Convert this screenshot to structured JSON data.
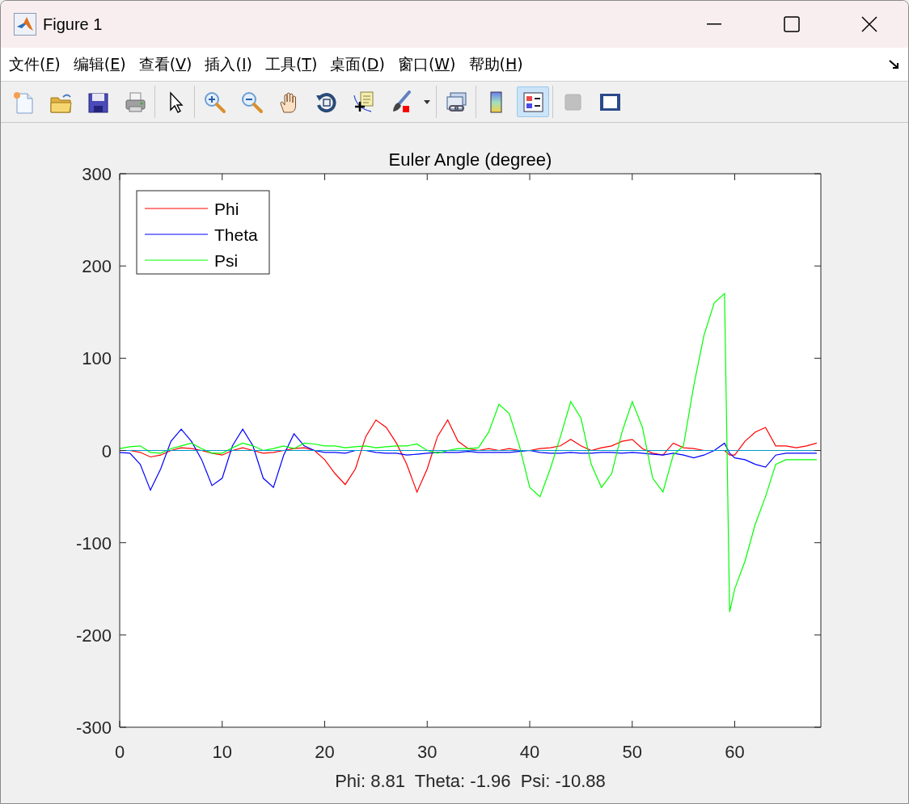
{
  "window": {
    "title": "Figure 1"
  },
  "menu": [
    {
      "label": "文件(F)"
    },
    {
      "label": "编辑(E)"
    },
    {
      "label": "查看(V)"
    },
    {
      "label": "插入(I)"
    },
    {
      "label": "工具(T)"
    },
    {
      "label": "桌面(D)"
    },
    {
      "label": "窗口(W)"
    },
    {
      "label": "帮助(H)"
    }
  ],
  "toolbar": {
    "groups": [
      {
        "tools": [
          {
            "kind": "new",
            "selected": false,
            "disabled": false
          },
          {
            "kind": "open",
            "selected": false,
            "disabled": false
          },
          {
            "kind": "save",
            "selected": false,
            "disabled": false
          },
          {
            "kind": "print",
            "selected": false,
            "disabled": false
          }
        ]
      },
      {
        "tools": [
          {
            "kind": "pointer",
            "selected": false,
            "disabled": false
          }
        ]
      },
      {
        "tools": [
          {
            "kind": "zoom-in",
            "selected": false,
            "disabled": false
          },
          {
            "kind": "zoom-out",
            "selected": false,
            "disabled": false
          },
          {
            "kind": "pan",
            "selected": false,
            "disabled": false
          },
          {
            "kind": "rotate",
            "selected": false,
            "disabled": false
          },
          {
            "kind": "data-cursor",
            "selected": false,
            "disabled": false
          },
          {
            "kind": "brush",
            "selected": false,
            "disabled": false
          },
          {
            "kind": "dropdown",
            "selected": false,
            "disabled": false
          }
        ]
      },
      {
        "tools": [
          {
            "kind": "link",
            "selected": false,
            "disabled": false
          }
        ]
      },
      {
        "tools": [
          {
            "kind": "colorbar",
            "selected": false,
            "disabled": false
          },
          {
            "kind": "legend",
            "selected": true,
            "disabled": false
          }
        ]
      },
      {
        "tools": [
          {
            "kind": "plot-tools-hide",
            "selected": false,
            "disabled": true
          },
          {
            "kind": "plot-tools-show",
            "selected": false,
            "disabled": false
          }
        ]
      }
    ]
  },
  "axes": {
    "chart_data": {
      "type": "line",
      "title": "Euler Angle (degree)",
      "xlabel": "Phi: 8.81  Theta: -1.96  Psi: -10.88",
      "x": [
        0,
        1,
        2,
        3,
        4,
        5,
        6,
        7,
        8,
        9,
        10,
        11,
        12,
        13,
        14,
        15,
        16,
        17,
        18,
        19,
        20,
        21,
        22,
        23,
        24,
        25,
        26,
        27,
        28,
        29,
        30,
        31,
        32,
        33,
        34,
        35,
        36,
        37,
        38,
        39,
        40,
        41,
        42,
        43,
        44,
        45,
        46,
        47,
        48,
        49,
        50,
        51,
        52,
        53,
        54,
        55,
        56,
        57,
        58,
        59,
        59.5,
        60,
        61,
        62,
        63,
        64,
        65,
        66,
        67,
        68
      ],
      "series": [
        {
          "name": "Phi",
          "color": "#ff0000",
          "values": [
            0,
            0,
            -2,
            -7,
            -5,
            0,
            3,
            2,
            0,
            -3,
            -5,
            0,
            3,
            0,
            -3,
            -2,
            0,
            2,
            3,
            0,
            -10,
            -25,
            -37,
            -20,
            15,
            33,
            25,
            8,
            -15,
            -45,
            -20,
            15,
            33,
            10,
            2,
            0,
            2,
            0,
            2,
            0,
            0,
            2,
            3,
            5,
            12,
            5,
            0,
            3,
            5,
            10,
            12,
            2,
            -3,
            -5,
            8,
            3,
            2,
            0,
            0,
            0,
            -5,
            -5,
            10,
            20,
            25,
            5,
            5,
            3,
            5,
            8
          ]
        },
        {
          "name": "Theta",
          "color": "#0000ff",
          "values": [
            -2,
            -3,
            -15,
            -43,
            -20,
            10,
            23,
            10,
            -10,
            -38,
            -30,
            5,
            23,
            5,
            -30,
            -40,
            -5,
            18,
            5,
            0,
            -2,
            -2,
            -3,
            0,
            0,
            -2,
            -3,
            -3,
            -5,
            -4,
            -3,
            -2,
            -2,
            -2,
            -1,
            -2,
            -2,
            -2,
            -2,
            -1,
            0,
            -2,
            -3,
            -3,
            -2,
            -3,
            -3,
            -2,
            -2,
            -3,
            -2,
            -3,
            -4,
            -5,
            -3,
            -5,
            -8,
            -5,
            0,
            8,
            -3,
            -8,
            -10,
            -15,
            -18,
            -5,
            -3,
            -3,
            -3,
            -3
          ]
        },
        {
          "name": "Psi",
          "color": "#00ff00",
          "values": [
            2,
            4,
            5,
            -2,
            -3,
            2,
            5,
            8,
            2,
            -3,
            -3,
            3,
            8,
            5,
            0,
            2,
            5,
            2,
            8,
            7,
            5,
            5,
            3,
            4,
            5,
            3,
            4,
            5,
            5,
            7,
            0,
            -3,
            0,
            2,
            2,
            3,
            20,
            50,
            40,
            5,
            -40,
            -50,
            -20,
            15,
            53,
            35,
            -15,
            -40,
            -25,
            20,
            53,
            25,
            -30,
            -45,
            -5,
            5,
            70,
            125,
            160,
            170,
            -175,
            -150,
            -120,
            -80,
            -50,
            -15,
            -10,
            -10,
            -10,
            -10
          ]
        }
      ],
      "legend": true,
      "ref_lines": [
        {
          "axis": "y",
          "value": 0,
          "color": "#0099cc"
        }
      ],
      "xlim": [
        0,
        68.4
      ],
      "ylim": [
        -300,
        300
      ],
      "xticks": [
        0,
        10,
        20,
        30,
        40,
        50,
        60
      ],
      "yticks": [
        -300,
        -200,
        -100,
        0,
        100,
        200,
        300
      ]
    }
  }
}
